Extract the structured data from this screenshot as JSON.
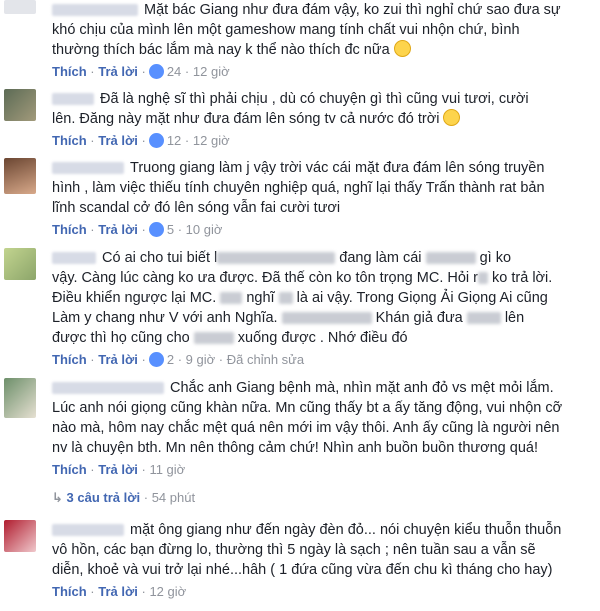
{
  "actions": {
    "like": "Thích",
    "reply": "Trả lời",
    "sep": "·",
    "edited": "Đã chỉnh sửa"
  },
  "comments": [
    {
      "lines": [
        "Mặt bác Giang như đưa đám vậy, ko zui thì nghỉ chứ sao đưa sự",
        "khó chịu của mình lên một gameshow mang tính chất vui nhộn chứ, bình",
        "thường thích bác lắm mà nay k thể nào thích đc nữa"
      ],
      "likes": "24",
      "time": "12 giờ",
      "emoji": "rolling-eyes-emoji"
    },
    {
      "lines": [
        "Đã là nghệ sĩ thì phải chịu , dù có chuyện gì thì cũng vui tươi, cười",
        "lên. Đăng này mặt như đưa đám lên sóng tv cả nước đó trời"
      ],
      "likes": "12",
      "time": "12 giờ",
      "emoji": "worried-emoji"
    },
    {
      "lines": [
        "Truong giang làm j vậy trời vác cái mặt đưa đám lên sóng truyền",
        "hình , làm việc thiếu tính chuyên nghiệp quá, nghĩ lại thấy Trấn thành rat bản",
        "lĩnh scandal cở đó lên sóng vẫn fai cười tươi"
      ],
      "likes": "5",
      "time": "10 giờ"
    },
    {
      "line1a": "Có ai cho tui biết l",
      "line1b": "đang làm cái",
      "line1c": "gì ko",
      "line2a": "vậy. Càng lúc càng ko ưa được. Đã thế còn ko tôn trọng MC. Hỏi r",
      "line2b": "ko trả lời.",
      "line3a": "Điều khiển ngược lại MC.",
      "line3b": "nghĩ",
      "line3c": "là ai vậy. Trong Giọng Ải Giọng Ai cũng",
      "line4": "Làm y chang như V với anh Nghĩa.",
      "line4b": "Khán giả đưa",
      "line4c": "lên",
      "line5a": "được thì họ cũng cho",
      "line5b": "xuống được . Nhớ điều đó",
      "likes": "2",
      "time": "9 giờ"
    },
    {
      "lines": [
        "Chắc anh Giang bệnh mà, nhìn mặt anh đỏ vs mệt mỏi lắm.",
        "Lúc anh nói giọng cũng khàn nữa. Mn cũng thấy bt a ấy tăng động, vui nhộn cỡ",
        "nào mà, hôm nay chắc mệt quá nên mới im vậy thôi. Anh ấy cũng là người nên",
        "nv là chuyện bth. Mn nên thông cảm chứ! Nhìn anh buồn buồn thương quá!"
      ],
      "time": "11 giờ"
    },
    {
      "lines": [
        "mặt ông giang như đến ngày đèn đỏ... nói chuyện kiểu thuỗn thuỗn",
        "vô hồn, các bạn đừng lo, thường thì 5 ngày là sạch ; nên tuần sau a vẫn sẽ",
        "diễn, khoẻ và vui trở lại nhé...hâh ( 1 đứa cũng vừa đến chu kì tháng cho hay)"
      ],
      "time": "12 giờ"
    }
  ],
  "replies": {
    "label": "3 câu trả lời",
    "time": "54 phút"
  },
  "colors": {
    "link": "#4267b2",
    "meta": "#90949c",
    "text": "#1d2129",
    "like": "#5890ff"
  }
}
